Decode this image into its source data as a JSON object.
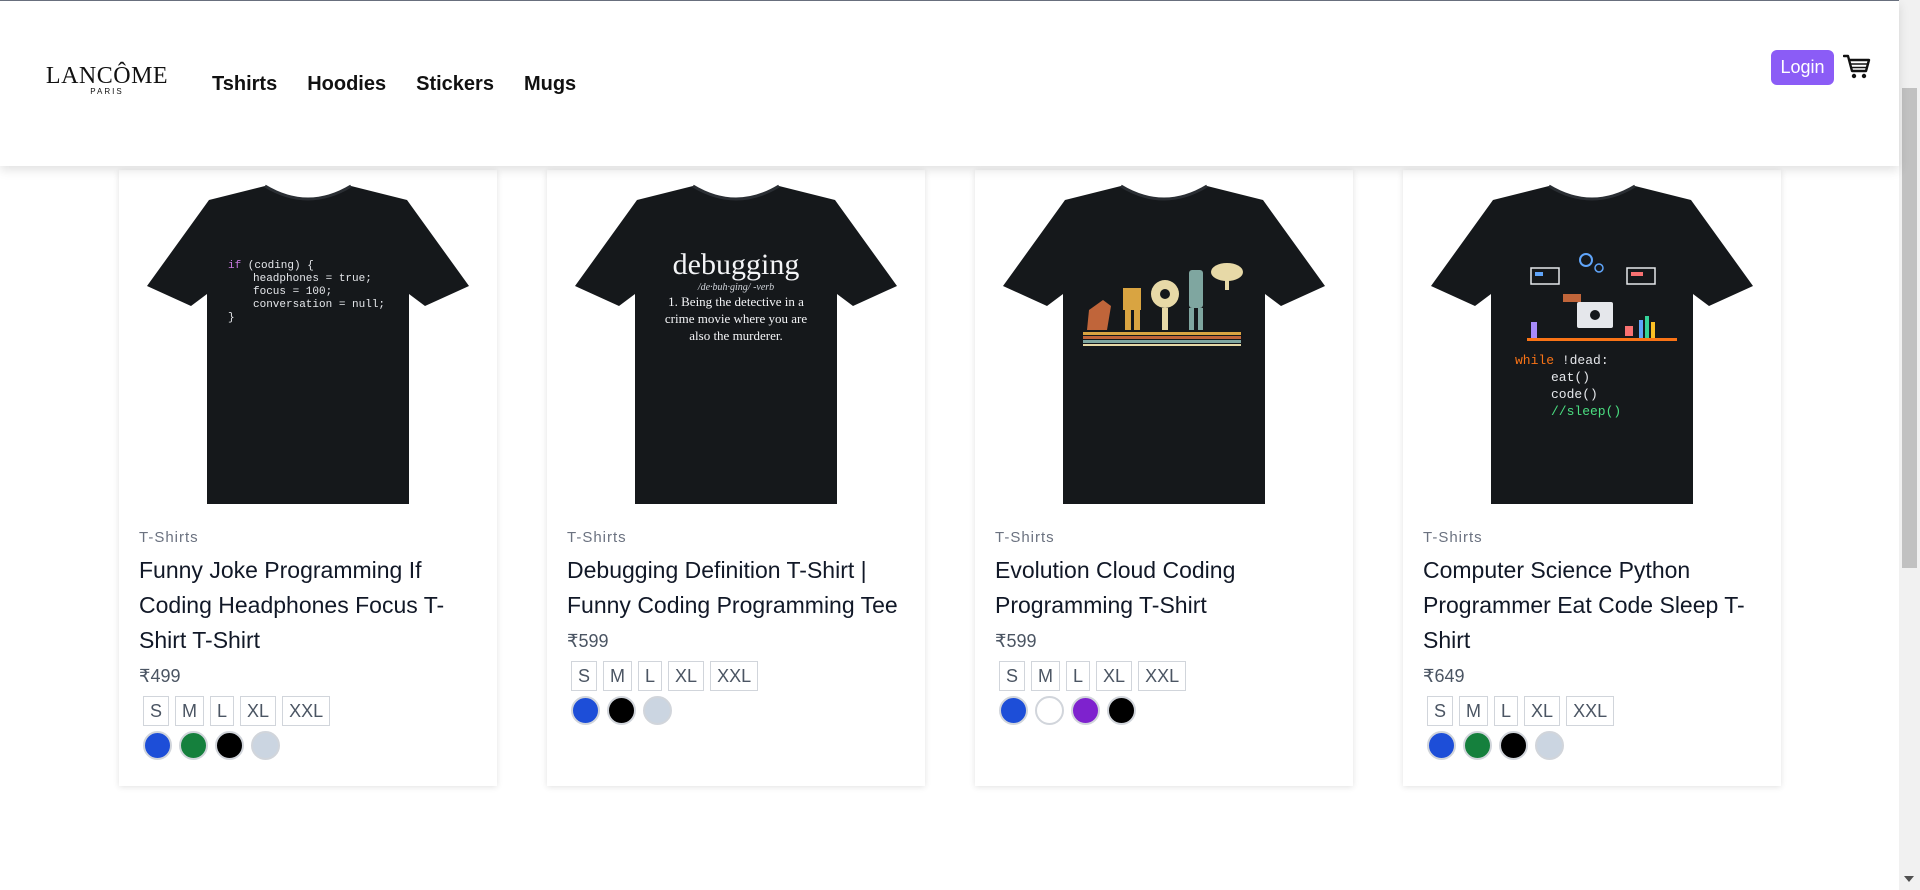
{
  "header": {
    "brand": "LANCÔME",
    "brand_sub": "PARIS",
    "nav": [
      "Tshirts",
      "Hoodies",
      "Stickers",
      "Mugs"
    ],
    "login_label": "Login",
    "accent": "#8b5cf6"
  },
  "products": [
    {
      "category": "T-Shirts",
      "title": "Funny Joke Programming If Coding Headphones Focus T-Shirt T-Shirt",
      "price": "₹499",
      "sizes": [
        "S",
        "M",
        "L",
        "XL",
        "XXL"
      ],
      "colors": [
        "#1d4ed8",
        "#15803d",
        "#000000",
        "#cbd5e1"
      ],
      "print": {
        "lines": [
          "if (coding) {",
          "headphones = true;",
          "focus = 100;",
          "conversation = null;",
          "}"
        ]
      }
    },
    {
      "category": "T-Shirts",
      "title": "Debugging Definition T-Shirt | Funny Coding Programming Tee",
      "price": "₹599",
      "sizes": [
        "S",
        "M",
        "L",
        "XL",
        "XXL"
      ],
      "colors": [
        "#1d4ed8",
        "#000000",
        "#cbd5e1"
      ],
      "print": {
        "heading": "debugging",
        "phonetic": "/de·buh·ging/ -verb",
        "definition": [
          "1. Being the detective in a",
          "crime movie where you are",
          "also the murderer."
        ]
      }
    },
    {
      "category": "T-Shirts",
      "title": "Evolution Cloud Coding Programming T-Shirt",
      "price": "₹599",
      "sizes": [
        "S",
        "M",
        "L",
        "XL",
        "XXL"
      ],
      "colors": [
        "#1d4ed8",
        "#ffffff",
        "#7e22ce",
        "#000000"
      ],
      "print": {}
    },
    {
      "category": "T-Shirts",
      "title": "Computer Science Python Programmer Eat Code Sleep T-Shirt",
      "price": "₹649",
      "sizes": [
        "S",
        "M",
        "L",
        "XL",
        "XXL"
      ],
      "colors": [
        "#1d4ed8",
        "#15803d",
        "#000000",
        "#cbd5e1"
      ],
      "print": {
        "code": [
          "while !dead:",
          "eat()",
          "code()",
          "//sleep()"
        ]
      }
    }
  ]
}
